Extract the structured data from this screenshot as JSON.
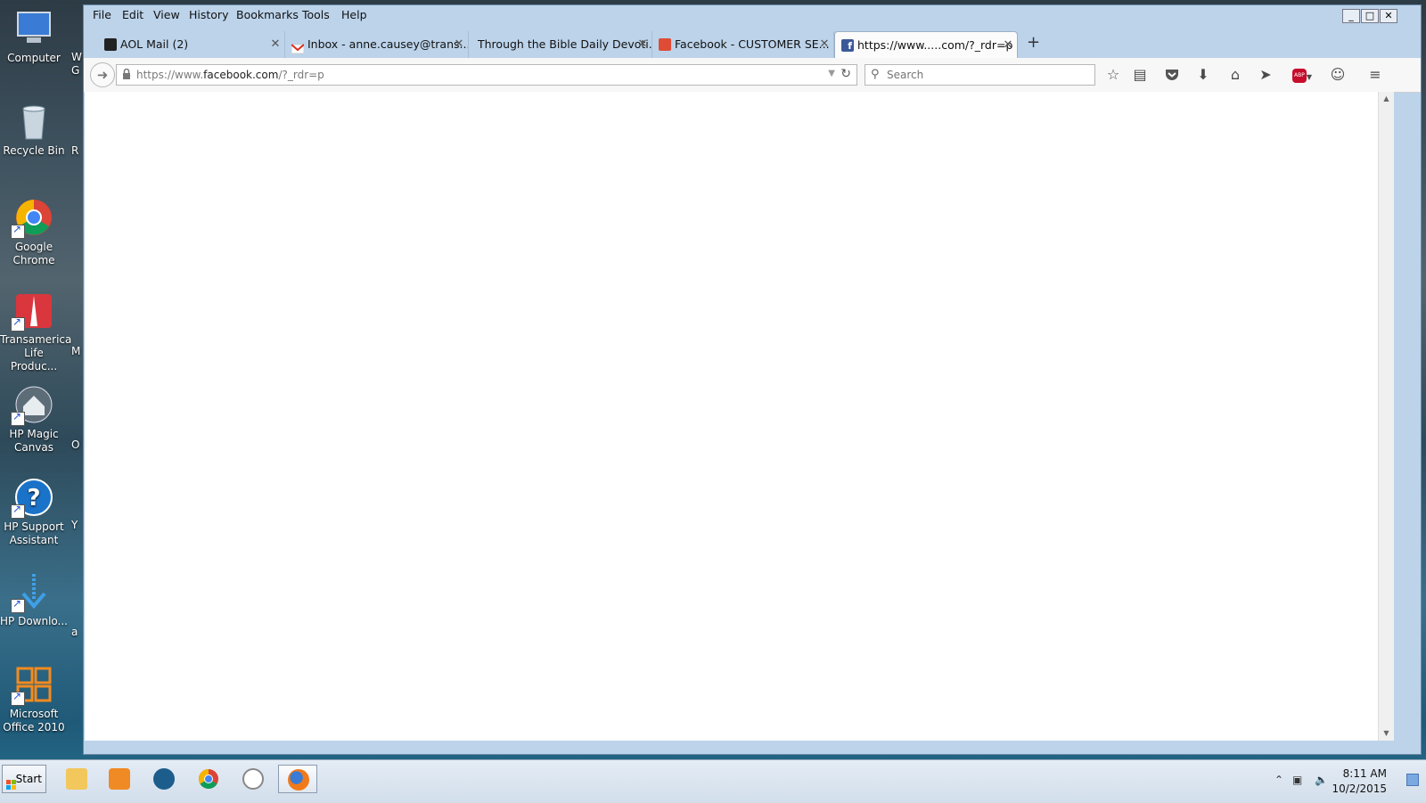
{
  "desktop": {
    "icons": [
      {
        "label": "Computer"
      },
      {
        "label": "Recycle Bin"
      },
      {
        "label": "Google Chrome"
      },
      {
        "label": "Transamerica Life Produc..."
      },
      {
        "label": "HP Magic Canvas"
      },
      {
        "label": "HP Support Assistant"
      },
      {
        "label": "HP Downlo..."
      },
      {
        "label": "Microsoft Office 2010"
      }
    ],
    "clipped_letters": [
      "W",
      "G",
      "R",
      "M",
      "O",
      "Y",
      "a"
    ]
  },
  "browser": {
    "menu": [
      "File",
      "Edit",
      "View",
      "History",
      "Bookmarks",
      "Tools",
      "Help"
    ],
    "window_controls": {
      "minimize": "_",
      "maximize": "□",
      "close": "✕"
    },
    "tabs": [
      {
        "title": "AOL Mail (2)",
        "favicon": "aol-icon",
        "color": "#222222",
        "active": false
      },
      {
        "title": "Inbox - anne.causey@trans...",
        "favicon": "gmail-icon",
        "color": "#d93025",
        "active": false
      },
      {
        "title": "Through the Bible Daily Devoti...",
        "favicon": "none",
        "color": "",
        "active": false
      },
      {
        "title": "Facebook - CUSTOMER SE...",
        "favicon": "red-page-icon",
        "color": "#e04b35",
        "active": false
      },
      {
        "title": "https://www.....com/?_rdr=p",
        "favicon": "facebook-icon",
        "color": "#3b5998",
        "active": true
      }
    ],
    "tab_close_glyph": "✕",
    "new_tab_glyph": "+",
    "url": {
      "prefix": "https://www.",
      "domain": "facebook.com",
      "suffix": "/?_rdr=p"
    },
    "search": {
      "placeholder": "Search",
      "value": ""
    },
    "toolbar_icons": [
      "bookmark-star-icon",
      "reading-list-icon",
      "pocket-icon",
      "download-icon",
      "home-icon",
      "send-icon",
      "adblock-plus-icon",
      "chat-icon",
      "hamburger-menu-icon"
    ],
    "adblock_badge": "ABP"
  },
  "taskbar": {
    "start_label": "Start",
    "pinned": [
      "file-explorer-icon",
      "media-player-icon",
      "hp-icon",
      "chrome-icon",
      "circle-slash-icon",
      "firefox-icon"
    ],
    "active_app": "firefox-icon",
    "clock_time": "8:11 AM",
    "clock_date": "10/2/2015"
  }
}
